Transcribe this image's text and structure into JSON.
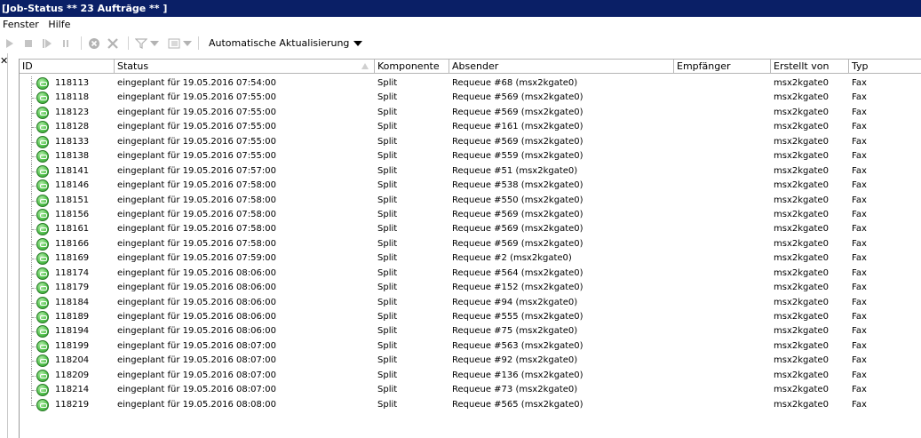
{
  "window": {
    "title": "[Job-Status  ** 23 Aufträge  ** ]"
  },
  "menu": {
    "items": [
      "Fenster",
      "Hilfe"
    ]
  },
  "toolbar": {
    "buttons": [
      "play-icon",
      "stop-icon",
      "step-icon",
      "pause-icon",
      "cancel-icon",
      "delete-icon",
      "filter-icon",
      "list-view-icon"
    ],
    "auto_refresh_label": "Automatische Aktualisierung"
  },
  "table": {
    "columns": [
      "ID",
      "Status",
      "Komponente",
      "Absender",
      "Empfänger",
      "Erstellt von",
      "Typ"
    ],
    "sorted_column": "Status",
    "rows": [
      {
        "id": "118113",
        "status": "eingeplant für 19.05.2016 07:54:00",
        "komponente": "Split",
        "absender": "Requeue #68 (msx2kgate0)",
        "empfaenger": "",
        "erstellt_von": "msx2kgate0",
        "typ": "Fax"
      },
      {
        "id": "118118",
        "status": "eingeplant für 19.05.2016 07:55:00",
        "komponente": "Split",
        "absender": "Requeue #569 (msx2kgate0)",
        "empfaenger": "",
        "erstellt_von": "msx2kgate0",
        "typ": "Fax"
      },
      {
        "id": "118123",
        "status": "eingeplant für 19.05.2016 07:55:00",
        "komponente": "Split",
        "absender": "Requeue #569 (msx2kgate0)",
        "empfaenger": "",
        "erstellt_von": "msx2kgate0",
        "typ": "Fax"
      },
      {
        "id": "118128",
        "status": "eingeplant für 19.05.2016 07:55:00",
        "komponente": "Split",
        "absender": "Requeue #161 (msx2kgate0)",
        "empfaenger": "",
        "erstellt_von": "msx2kgate0",
        "typ": "Fax"
      },
      {
        "id": "118133",
        "status": "eingeplant für 19.05.2016 07:55:00",
        "komponente": "Split",
        "absender": "Requeue #569 (msx2kgate0)",
        "empfaenger": "",
        "erstellt_von": "msx2kgate0",
        "typ": "Fax"
      },
      {
        "id": "118138",
        "status": "eingeplant für 19.05.2016 07:55:00",
        "komponente": "Split",
        "absender": "Requeue #559 (msx2kgate0)",
        "empfaenger": "",
        "erstellt_von": "msx2kgate0",
        "typ": "Fax"
      },
      {
        "id": "118141",
        "status": "eingeplant für 19.05.2016 07:57:00",
        "komponente": "Split",
        "absender": "Requeue #51 (msx2kgate0)",
        "empfaenger": "",
        "erstellt_von": "msx2kgate0",
        "typ": "Fax"
      },
      {
        "id": "118146",
        "status": "eingeplant für 19.05.2016 07:58:00",
        "komponente": "Split",
        "absender": "Requeue #538 (msx2kgate0)",
        "empfaenger": "",
        "erstellt_von": "msx2kgate0",
        "typ": "Fax"
      },
      {
        "id": "118151",
        "status": "eingeplant für 19.05.2016 07:58:00",
        "komponente": "Split",
        "absender": "Requeue #550 (msx2kgate0)",
        "empfaenger": "",
        "erstellt_von": "msx2kgate0",
        "typ": "Fax"
      },
      {
        "id": "118156",
        "status": "eingeplant für 19.05.2016 07:58:00",
        "komponente": "Split",
        "absender": "Requeue #569 (msx2kgate0)",
        "empfaenger": "",
        "erstellt_von": "msx2kgate0",
        "typ": "Fax"
      },
      {
        "id": "118161",
        "status": "eingeplant für 19.05.2016 07:58:00",
        "komponente": "Split",
        "absender": "Requeue #569 (msx2kgate0)",
        "empfaenger": "",
        "erstellt_von": "msx2kgate0",
        "typ": "Fax"
      },
      {
        "id": "118166",
        "status": "eingeplant für 19.05.2016 07:58:00",
        "komponente": "Split",
        "absender": "Requeue #569 (msx2kgate0)",
        "empfaenger": "",
        "erstellt_von": "msx2kgate0",
        "typ": "Fax"
      },
      {
        "id": "118169",
        "status": "eingeplant für 19.05.2016 07:59:00",
        "komponente": "Split",
        "absender": "Requeue #2 (msx2kgate0)",
        "empfaenger": "",
        "erstellt_von": "msx2kgate0",
        "typ": "Fax"
      },
      {
        "id": "118174",
        "status": "eingeplant für 19.05.2016 08:06:00",
        "komponente": "Split",
        "absender": "Requeue #564 (msx2kgate0)",
        "empfaenger": "",
        "erstellt_von": "msx2kgate0",
        "typ": "Fax"
      },
      {
        "id": "118179",
        "status": "eingeplant für 19.05.2016 08:06:00",
        "komponente": "Split",
        "absender": "Requeue #152 (msx2kgate0)",
        "empfaenger": "",
        "erstellt_von": "msx2kgate0",
        "typ": "Fax"
      },
      {
        "id": "118184",
        "status": "eingeplant für 19.05.2016 08:06:00",
        "komponente": "Split",
        "absender": "Requeue #94 (msx2kgate0)",
        "empfaenger": "",
        "erstellt_von": "msx2kgate0",
        "typ": "Fax"
      },
      {
        "id": "118189",
        "status": "eingeplant für 19.05.2016 08:06:00",
        "komponente": "Split",
        "absender": "Requeue #555 (msx2kgate0)",
        "empfaenger": "",
        "erstellt_von": "msx2kgate0",
        "typ": "Fax"
      },
      {
        "id": "118194",
        "status": "eingeplant für 19.05.2016 08:06:00",
        "komponente": "Split",
        "absender": "Requeue #75 (msx2kgate0)",
        "empfaenger": "",
        "erstellt_von": "msx2kgate0",
        "typ": "Fax"
      },
      {
        "id": "118199",
        "status": "eingeplant für 19.05.2016 08:07:00",
        "komponente": "Split",
        "absender": "Requeue #563 (msx2kgate0)",
        "empfaenger": "",
        "erstellt_von": "msx2kgate0",
        "typ": "Fax"
      },
      {
        "id": "118204",
        "status": "eingeplant für 19.05.2016 08:07:00",
        "komponente": "Split",
        "absender": "Requeue #92 (msx2kgate0)",
        "empfaenger": "",
        "erstellt_von": "msx2kgate0",
        "typ": "Fax"
      },
      {
        "id": "118209",
        "status": "eingeplant für 19.05.2016 08:07:00",
        "komponente": "Split",
        "absender": "Requeue #136 (msx2kgate0)",
        "empfaenger": "",
        "erstellt_von": "msx2kgate0",
        "typ": "Fax"
      },
      {
        "id": "118214",
        "status": "eingeplant für 19.05.2016 08:07:00",
        "komponente": "Split",
        "absender": "Requeue #73 (msx2kgate0)",
        "empfaenger": "",
        "erstellt_von": "msx2kgate0",
        "typ": "Fax"
      },
      {
        "id": "118219",
        "status": "eingeplant für 19.05.2016 08:08:00",
        "komponente": "Split",
        "absender": "Requeue #565 (msx2kgate0)",
        "empfaenger": "",
        "erstellt_von": "msx2kgate0",
        "typ": "Fax"
      }
    ]
  },
  "colors": {
    "titlebar_bg": "#0a1f66",
    "titlebar_text": "#ffffff",
    "job_icon": "#4fbf4a"
  }
}
